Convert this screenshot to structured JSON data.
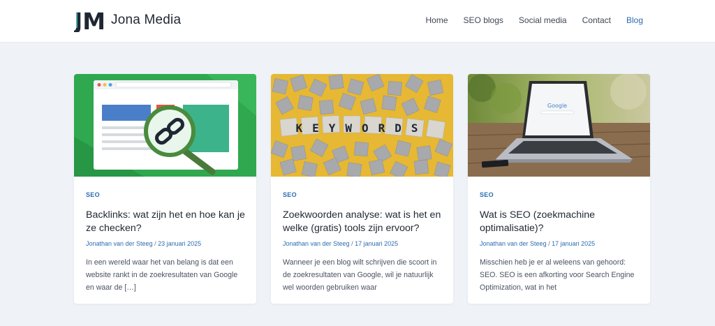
{
  "site": {
    "title": "Jona Media",
    "logo_text": "JM"
  },
  "nav": [
    {
      "label": "Home"
    },
    {
      "label": "SEO blogs"
    },
    {
      "label": "Social media"
    },
    {
      "label": "Contact"
    },
    {
      "label": "Blog",
      "active": true
    }
  ],
  "posts": [
    {
      "category": "SEO",
      "title": "Backlinks: wat zijn het en hoe kan je ze checken?",
      "author": "Jonathan van der Steeg",
      "separator": "/",
      "date": "23 januari 2025",
      "excerpt": "In een wereld waar het van belang is dat een website rankt in de zoekresultaten van Google en waar de […]",
      "image": "backlink-magnifier-illustration"
    },
    {
      "category": "SEO",
      "title": "Zoekwoorden analyse: wat is het en welke (gratis) tools zijn ervoor?",
      "author": "Jonathan van der Steeg",
      "separator": "/",
      "date": "17 januari 2025",
      "excerpt": "Wanneer je een blog wilt schrijven die scoort in de zoekresultaten van Google, wil je natuurlijk wel woorden gebruiken waar",
      "image": "keywords-tiles-photo",
      "image_text": "KEYWORDS"
    },
    {
      "category": "SEO",
      "title": "Wat is SEO (zoekmachine optimalisatie)?",
      "author": "Jonathan van der Steeg",
      "separator": "/",
      "date": "17 januari 2025",
      "excerpt": "Misschien heb je er al weleens van gehoord: SEO. SEO is een afkorting voor Search Engine Optimization, wat in het",
      "image": "laptop-google-photo",
      "image_text": "Google"
    }
  ],
  "colors": {
    "accent": "#2b6cb0",
    "background": "#eff3f7",
    "card": "#ffffff",
    "text": "#1f2733"
  }
}
